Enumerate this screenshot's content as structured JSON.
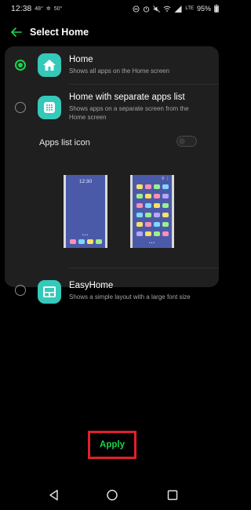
{
  "status_bar": {
    "time": "12:38",
    "temp1": "48°",
    "temp2": "50°",
    "network": "LTE",
    "battery": "95%"
  },
  "header": {
    "title": "Select Home"
  },
  "options": [
    {
      "title": "Home",
      "description": "Shows all apps on the Home screen",
      "selected": true,
      "icon": "home-icon"
    },
    {
      "title": "Home with separate apps list",
      "description_line1": "Shows apps on a separate screen from the",
      "description_line2": "Home screen",
      "selected": false,
      "icon": "apps-grid-icon",
      "apps_list_icon_label": "Apps list icon",
      "apps_list_icon_enabled": false,
      "preview_time": "12:30"
    },
    {
      "title": "EasyHome",
      "description": "Shows a simple layout with a large font size",
      "selected": false,
      "icon": "easyhome-icon"
    }
  ],
  "apply_button": {
    "label": "Apply"
  },
  "colors": {
    "accent": "#19d44e",
    "highlight_box": "#e0202b",
    "card_bg": "#1f1f1f",
    "icon_bg": "#34c9b9",
    "preview_bg": "#4b5aa8"
  }
}
